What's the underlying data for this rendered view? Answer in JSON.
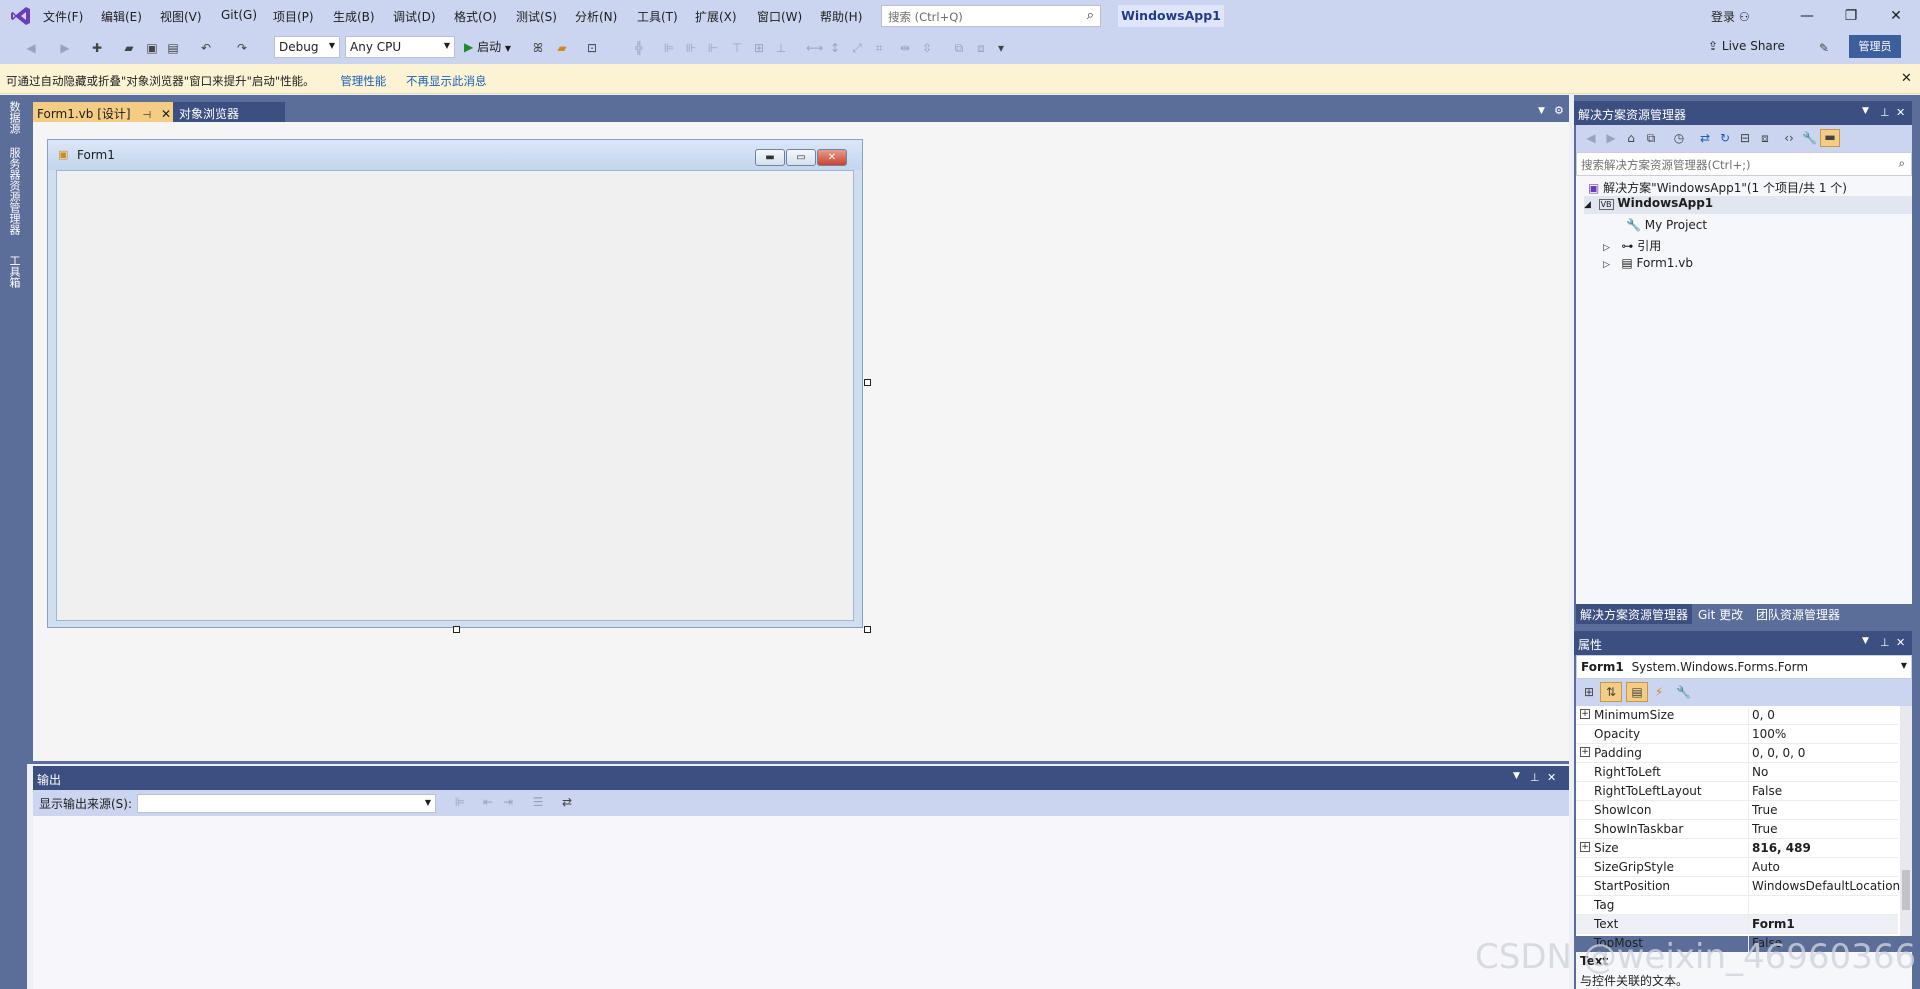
{
  "menubar": {
    "items": [
      "文件(F)",
      "编辑(E)",
      "视图(V)",
      "Git(G)",
      "项目(P)",
      "生成(B)",
      "调试(D)",
      "格式(O)",
      "测试(S)",
      "分析(N)",
      "工具(T)",
      "扩展(X)",
      "窗口(W)",
      "帮助(H)"
    ],
    "search_placeholder": "搜索 (Ctrl+Q)",
    "solution_name": "WindowsApp1",
    "login": "登录"
  },
  "toolbar": {
    "config": "Debug",
    "platform": "Any CPU",
    "start": "启动",
    "live_share": "Live Share",
    "admin": "管理员"
  },
  "infobar": {
    "message": "可通过自动隐藏或折叠\"对象浏览器\"窗口来提升\"启动\"性能。",
    "link_manage": "管理性能",
    "link_dismiss": "不再显示此消息"
  },
  "left_strip": [
    "数据源",
    "服务器资源管理器",
    "工具箱"
  ],
  "tabs": {
    "active": "Form1.vb [设计]",
    "second": "对象浏览器"
  },
  "form": {
    "title": "Form1"
  },
  "output": {
    "title": "输出",
    "source_label": "显示输出来源(S):"
  },
  "solution_explorer": {
    "title": "解决方案资源管理器",
    "search_placeholder": "搜索解决方案资源管理器(Ctrl+;)",
    "tree": [
      {
        "label": "解决方案\"WindowsApp1\"(1 个项目/共 1 个)"
      },
      {
        "label": "WindowsApp1",
        "badge": "VB"
      },
      {
        "label": "My Project"
      },
      {
        "label": "引用"
      },
      {
        "label": "Form1.vb"
      }
    ],
    "bottom_tabs": [
      "解决方案资源管理器",
      "Git 更改",
      "团队资源管理器"
    ]
  },
  "properties": {
    "title": "属性",
    "object_name": "Form1",
    "object_type": "System.Windows.Forms.Form",
    "rows": [
      {
        "name": "MinimumSize",
        "value": "0, 0",
        "expandable": true
      },
      {
        "name": "Opacity",
        "value": "100%"
      },
      {
        "name": "Padding",
        "value": "0, 0, 0, 0",
        "expandable": true
      },
      {
        "name": "RightToLeft",
        "value": "No"
      },
      {
        "name": "RightToLeftLayout",
        "value": "False"
      },
      {
        "name": "ShowIcon",
        "value": "True"
      },
      {
        "name": "ShowInTaskbar",
        "value": "True"
      },
      {
        "name": "Size",
        "value": "816, 489",
        "expandable": true,
        "bold": true
      },
      {
        "name": "SizeGripStyle",
        "value": "Auto"
      },
      {
        "name": "StartPosition",
        "value": "WindowsDefaultLocation"
      },
      {
        "name": "Tag",
        "value": ""
      },
      {
        "name": "Text",
        "value": "Form1",
        "bold": true,
        "selected": true
      },
      {
        "name": "TopMost",
        "value": "False"
      }
    ],
    "desc_title": "Text",
    "desc_text": "与控件关联的文本。"
  },
  "watermark": "CSDN @weixin_46960366",
  "colors": {
    "accent": "#3b4f81",
    "chrome": "#ccd5f0",
    "infobar": "#fcf3d5",
    "active_tab": "#f5cc84"
  }
}
